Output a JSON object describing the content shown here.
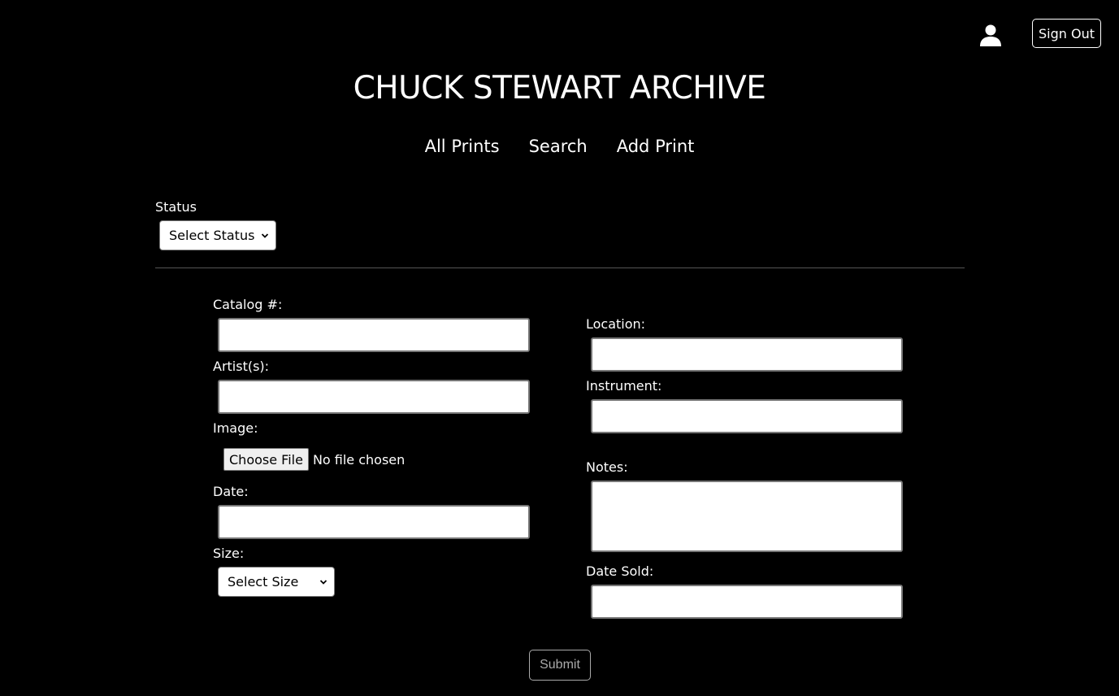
{
  "header": {
    "user_icon": "user-icon",
    "sign_out_label": "Sign Out",
    "title": "CHUCK STEWART ARCHIVE"
  },
  "nav": {
    "items": [
      {
        "label": "All Prints"
      },
      {
        "label": "Search"
      },
      {
        "label": "Add Print"
      }
    ]
  },
  "status": {
    "label": "Status",
    "selected": "Select Status"
  },
  "form": {
    "catalog_label": "Catalog #:",
    "catalog_value": "",
    "artists_label": "Artist(s):",
    "artists_value": "",
    "image_label": "Image:",
    "choose_file_label": "Choose File",
    "no_file_text": "No file chosen",
    "date_label": "Date:",
    "date_value": "",
    "size_label": "Size:",
    "size_selected": "Select Size",
    "location_label": "Location:",
    "location_value": "",
    "instrument_label": "Instrument:",
    "instrument_value": "",
    "notes_label": "Notes:",
    "notes_value": "",
    "date_sold_label": "Date Sold:",
    "date_sold_value": "",
    "submit_label": "Submit"
  }
}
